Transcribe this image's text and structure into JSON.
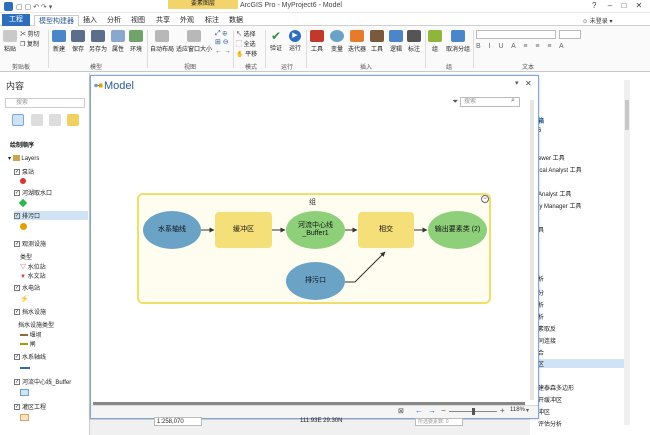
{
  "window": {
    "context_tab": "要素图层",
    "title": "ArcGIS Pro - MyProject6 - Model",
    "user": "未登录"
  },
  "tabs": [
    "工程",
    "模型构建器",
    "插入",
    "分析",
    "视图",
    "共享",
    "外观",
    "标注",
    "数据"
  ],
  "ribbon": {
    "clipboard": [
      "粘贴",
      "剪切",
      "复制"
    ],
    "model": [
      "新建",
      "保存",
      "另存为",
      "属性",
      "环境"
    ],
    "view": [
      "自动布局",
      "适应窗口大小"
    ],
    "mode": [
      "选择",
      "全选",
      "平移"
    ],
    "run": [
      "验证",
      "运行"
    ],
    "insert": [
      "工具",
      "变量",
      "迭代器",
      "工具",
      "逻辑",
      "标注"
    ],
    "group": [
      "组",
      "取消分组"
    ],
    "groups": [
      "剪贴板",
      "模型",
      "视图",
      "模式",
      "运行",
      "插入",
      "组",
      "文本"
    ]
  },
  "contents": {
    "title": "内容",
    "search_placeholder": "搜索",
    "draw_order": "绘制顺序",
    "items": [
      "Layers",
      "泵站",
      "河湖取水口",
      "排污口",
      "观测设施",
      "类型",
      "水位站",
      "水文站",
      "水电站",
      "挡水设施",
      "挡水设施类型",
      "堰坝",
      "闸",
      "水系轴线",
      "河流中心线_Buffer",
      "灌区工程"
    ]
  },
  "model": {
    "title": "Model",
    "search_placeholder": "搜索",
    "group_label": "组",
    "nodes": {
      "n1": "水系轴线",
      "n2": "缓冲区",
      "n3": "河流中心线_Buffer1",
      "n4": "相交",
      "n5": "输出要素类 (2)",
      "n6": "排污口"
    },
    "zoom": "118%"
  },
  "right_pane": [
    "箱",
    "6",
    "ewer 工具",
    "ical Analyst 工具",
    "Analyst 工具",
    "ly Manager 工具",
    "具",
    "析",
    "分",
    "析",
    "析",
    "素取反",
    "同连接",
    "合",
    "区",
    "建泰森多边形",
    "开缓冲区",
    "冲区",
    "评估分析"
  ],
  "status": {
    "scale": "1:258,070",
    "coords": "111.93E 29.30N",
    "selected": "所选要素数: 0"
  }
}
